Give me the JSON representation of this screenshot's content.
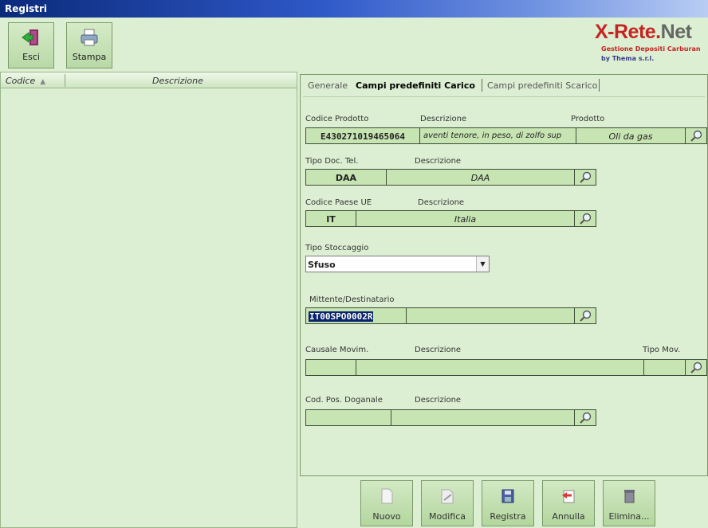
{
  "window": {
    "title": "Registri"
  },
  "toolbar": {
    "exit_label": "Esci",
    "print_label": "Stampa"
  },
  "logo": {
    "title_a": "X-Rete.",
    "title_b": "Net",
    "subtitle": "Gestione Depositi Carburan",
    "byline": "by Thema s.r.l."
  },
  "list": {
    "col_code": "Codice",
    "col_desc": "Descrizione"
  },
  "tabs": [
    {
      "label": "Generale"
    },
    {
      "label": "Campi predefiniti Carico"
    },
    {
      "label": "Campi predefiniti Scarico"
    }
  ],
  "form": {
    "prodotto": {
      "label_code": "Codice Prodotto",
      "label_desc": "Descrizione",
      "label_prod": "Prodotto",
      "code": "E430271019465064",
      "desc": "aventi tenore, in peso, di zolfo sup",
      "prod": "Oli da gas"
    },
    "tipo_doc": {
      "label_code": "Tipo Doc. Tel.",
      "label_desc": "Descrizione",
      "code": "DAA",
      "desc": "DAA"
    },
    "paese": {
      "label_code": "Codice Paese UE",
      "label_desc": "Descrizione",
      "code": "IT",
      "desc": "Italia"
    },
    "stoccaggio": {
      "label": "Tipo Stoccaggio",
      "value": "Sfuso"
    },
    "mittente": {
      "label": "Mittente/Destinatario",
      "code": "IT00SPO0002R",
      "desc": ""
    },
    "causale": {
      "label_code": "Causale Movim.",
      "label_desc": "Descrizione",
      "label_tipo": "Tipo Mov.",
      "code": "",
      "desc": "",
      "tipo": ""
    },
    "posdog": {
      "label_code": "Cod. Pos. Doganale",
      "label_desc": "Descrizione",
      "code": "",
      "desc": ""
    }
  },
  "actions": {
    "new_label": "Nuovo",
    "edit_label": "Modifica",
    "save_label": "Registra",
    "cancel_label": "Annulla",
    "delete_label": "Elimina..."
  }
}
